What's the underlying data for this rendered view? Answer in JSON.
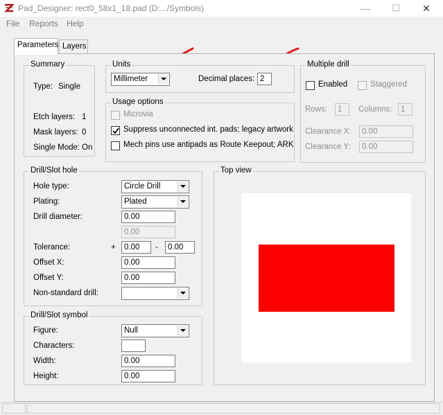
{
  "window": {
    "title": "Pad_Designer: rect0_58x1_18.pad (D:.../Symbols)",
    "min_glyph": "—",
    "max_glyph": "☐",
    "close_glyph": "✕"
  },
  "menu": [
    "File",
    "Reports",
    "Help"
  ],
  "tabs": [
    {
      "label": "Parameters"
    },
    {
      "label": "Layers"
    }
  ],
  "summary": {
    "title": "Summary",
    "type_label": "Type:",
    "type_value": "Single",
    "etch_label": "Etch layers:",
    "etch_value": "1",
    "mask_label": "Mask layers:",
    "mask_value": "0",
    "single_label": "Single Mode:",
    "single_value": "On"
  },
  "units": {
    "title": "Units",
    "unit_value": "Millimeter",
    "decimal_label": "Decimal places:",
    "decimal_value": "2"
  },
  "usage": {
    "title": "Usage options",
    "microvia": "Microvia",
    "suppress": "Suppress unconnected int. pads; legacy artwork",
    "mech": "Mech pins use antipads as Route Keepout; ARK"
  },
  "multi_drill": {
    "title": "Multiple drill",
    "enabled": "Enabled",
    "staggered": "Staggered",
    "rows_label": "Rows:",
    "rows_value": "1",
    "cols_label": "Columns:",
    "cols_value": "1",
    "clear_x_label": "Clearance X:",
    "clear_x_value": "0.00",
    "clear_y_label": "Clearance Y:",
    "clear_y_value": "0.00"
  },
  "drill_hole": {
    "title": "Drill/Slot hole",
    "hole_type_label": "Hole type:",
    "hole_type_value": "Circle Drill",
    "plating_label": "Plating:",
    "plating_value": "Plated",
    "diameter_label": "Drill diameter:",
    "diameter_value": "0.00",
    "diameter2_value": "0.00",
    "tolerance_label": "Tolerance:",
    "plus": "+",
    "minus": "-",
    "tol_plus_value": "0.00",
    "tol_minus_value": "0.00",
    "offset_x_label": "Offset X:",
    "offset_x_value": "0.00",
    "offset_y_label": "Offset Y:",
    "offset_y_value": "0.00",
    "nonstd_label": "Non-standard drill:",
    "nonstd_value": ""
  },
  "drill_symbol": {
    "title": "Drill/Slot symbol",
    "figure_label": "Figure:",
    "figure_value": "Null",
    "chars_label": "Characters:",
    "chars_value": "",
    "width_label": "Width:",
    "width_value": "0.00",
    "height_label": "Height:",
    "height_value": "0.00"
  },
  "top_view": {
    "title": "Top view",
    "pad_color": "#ff0000"
  },
  "colors": {
    "annotation": "#e01a1a"
  }
}
